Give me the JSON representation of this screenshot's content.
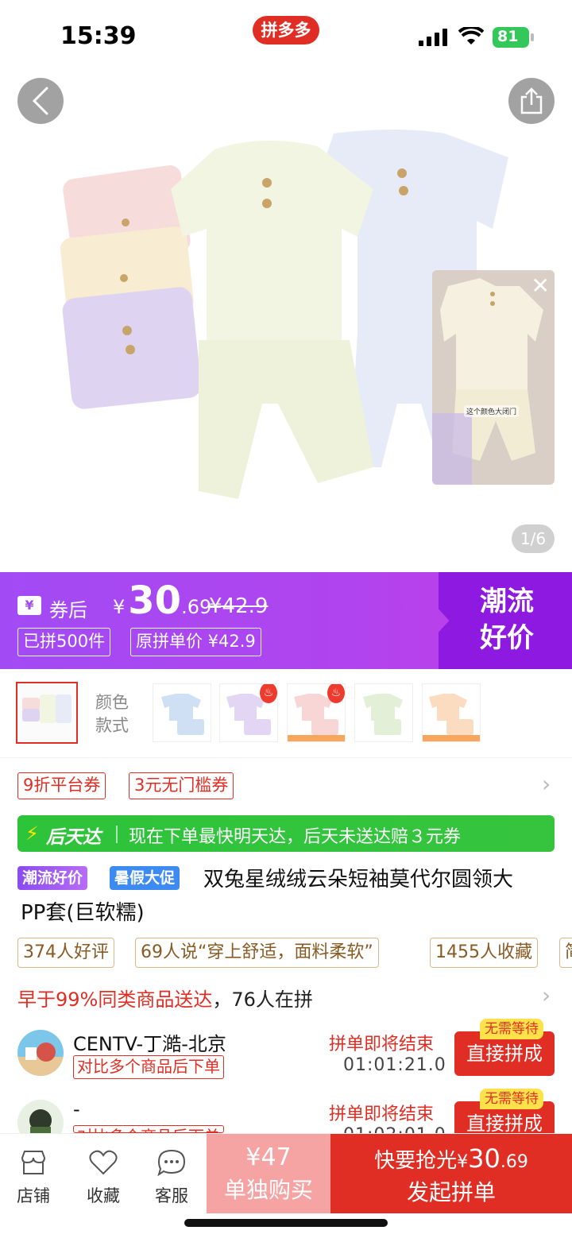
{
  "status_bar": {
    "time": "15:39",
    "app_badge": "拼多多",
    "battery": "81"
  },
  "hero": {
    "page_indicator": "1/6",
    "video_close": "✕",
    "video_caption": "这个颜色大闭门"
  },
  "price": {
    "after_coupon_label": "券后",
    "coupon_icon": "¥",
    "currency": "¥",
    "price_int": "30",
    "price_dec": ".69",
    "original": "¥42.9",
    "sold": "已拼500件",
    "orig_single": "原拼单价 ¥42.9",
    "trend_line1": "潮流",
    "trend_line2": "好价",
    "accent": "#a24bf4"
  },
  "variants": {
    "label_line1": "颜色",
    "label_line2": "款式"
  },
  "coupons": [
    "9折平台券",
    "3元无门槛券"
  ],
  "delivery": {
    "badge": "后天达",
    "desc": "现在下单最快明天达，后天未送达赔３元券",
    "color": "#2dc33a"
  },
  "title": {
    "badge1": "潮流好价",
    "badge2": "暑假大促",
    "line1": "双兔星绒绒云朵短袖莫代尔圆领大",
    "line2": "PP套(巨软糯)"
  },
  "review_tags": [
    "374人好评",
    "69人说“穿上舒适，面料柔软”",
    "1455人收藏",
    "简"
  ],
  "early": {
    "highlight": "早于99%同类商品送达",
    "rest": "，76人在拼"
  },
  "groups": [
    {
      "name": "CENTV-丁澔-北京",
      "tag": "对比多个商品后下单",
      "ending": "拼单即将结束",
      "time": "01:01:21.0",
      "button": "直接拼成",
      "no_wait": "无需等待"
    },
    {
      "name": "-",
      "tag": "对比多个商品后下单",
      "ending": "拼单即将结束",
      "time": "01:02:01.0",
      "button": "直接拼成",
      "no_wait": "无需等待"
    }
  ],
  "bottom": {
    "store": "店铺",
    "favorite": "收藏",
    "service": "客服",
    "single_price": "¥47",
    "single_label": "单独购买",
    "group_prefix": "快要抢光",
    "group_currency": "¥",
    "group_int": "30",
    "group_dec": ".69",
    "group_label": "发起拼单"
  }
}
